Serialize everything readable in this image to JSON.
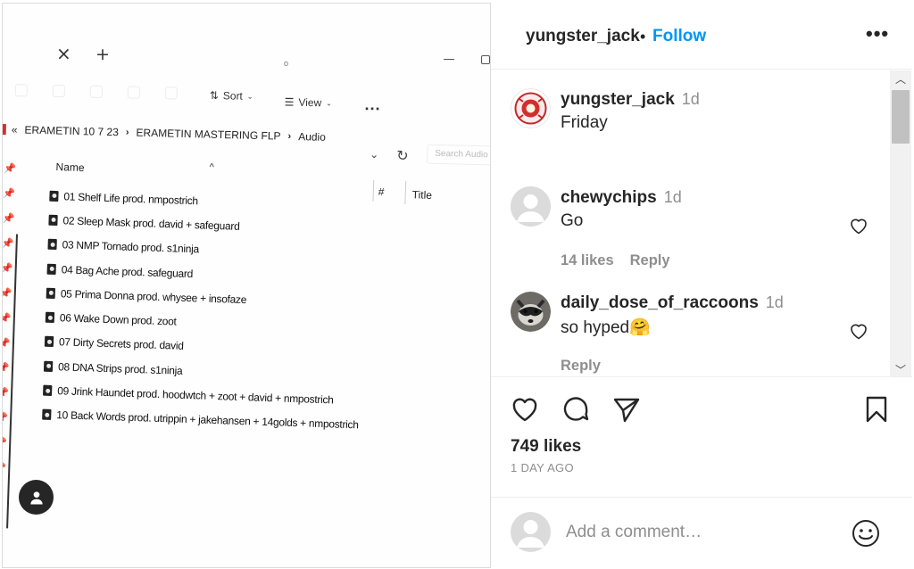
{
  "photo": {
    "tab_close": "×",
    "tab_add": "+",
    "tab_dot": "o",
    "toolbar": {
      "sort_label": "Sort",
      "view_label": "View",
      "more_label": "..."
    },
    "address": {
      "back": "«",
      "crumbs": [
        "ERAMETIN 10 7 23",
        "ERAMETIN MASTERING FLP",
        "Audio"
      ],
      "search_placeholder": "Search Audio"
    },
    "columns": {
      "name": "Name",
      "number": "#",
      "title": "Title"
    },
    "files": [
      "01 Shelf Life prod. nmpostrich",
      "02 Sleep Mask prod. david + safeguard",
      "03 NMP Tornado prod. s1ninja",
      "04 Bag Ache prod. safeguard",
      "05 Prima Donna prod. whysee + insofaze",
      "06 Wake Down prod. zoot",
      "07 Dirty Secrets prod. david",
      "08 DNA Strips prod. s1ninja",
      "09 Jrink Haundet prod. hoodwtch + zoot + david + nmpostrich",
      "10 Back Words prod. utrippin + jakehansen + 14golds + nmpostrich"
    ]
  },
  "post": {
    "header": {
      "username": "yungster_jack",
      "separator": "•",
      "follow_label": "Follow",
      "more_label": "•••"
    },
    "caption": {
      "username": "yungster_jack",
      "time": "1d",
      "text": "Friday"
    },
    "comments": [
      {
        "username": "chewychips",
        "time": "1d",
        "text": "Go",
        "likes": "14 likes",
        "reply_label": "Reply"
      },
      {
        "username": "daily_dose_of_raccoons",
        "time": "1d",
        "text": "so hyped🤗",
        "reply_label": "Reply"
      }
    ],
    "likes_text": "749 likes",
    "time_ago": "1 DAY AGO",
    "add_comment_placeholder": "Add a comment…"
  },
  "icons": {
    "like": "heart-icon",
    "comment": "comment-icon",
    "share": "share-icon",
    "save": "bookmark-icon",
    "emoji": "emoji-icon",
    "profile": "user-icon"
  },
  "colors": {
    "follow_blue": "#0095f6",
    "muted_text": "#8e8e8e",
    "primary_text": "#262626",
    "divider": "#dbdbdb"
  }
}
